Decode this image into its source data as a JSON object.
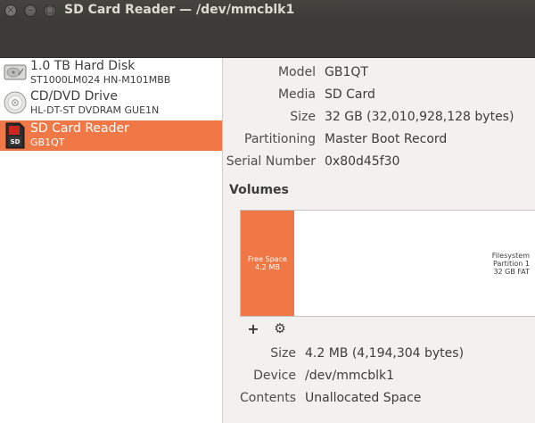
{
  "window": {
    "title": "SD Card Reader — /dev/mmcblk1",
    "close_glyph": "×",
    "minimize_glyph": "–",
    "maximize_glyph": "□"
  },
  "devices": [
    {
      "name": "1.0 TB Hard Disk",
      "sub": "ST1000LM024 HN-M101MBB",
      "icon": "hard-disk-icon",
      "selected": false
    },
    {
      "name": "CD/DVD Drive",
      "sub": "HL-DT-ST DVDRAM GUE1N",
      "icon": "optical-drive-icon",
      "selected": false
    },
    {
      "name": "SD Card Reader",
      "sub": "GB1QT",
      "icon": "sd-card-icon",
      "icon_text": "SD",
      "selected": true
    }
  ],
  "drive_properties": [
    {
      "label": "Model",
      "value": "GB1QT"
    },
    {
      "label": "Media",
      "value": "SD Card"
    },
    {
      "label": "Size",
      "value": "32 GB (32,010,928,128 bytes)"
    },
    {
      "label": "Partitioning",
      "value": "Master Boot Record"
    },
    {
      "label": "Serial Number",
      "value": "0x80d45f30"
    }
  ],
  "volumes": {
    "heading": "Volumes",
    "segments": [
      {
        "line1": "Free Space",
        "line2": "4.2 MB",
        "selected": true
      },
      {
        "line1": "Filesystem",
        "line2": "Partition 1",
        "line3": "32 GB FAT",
        "selected": false
      }
    ],
    "add_glyph": "+",
    "settings_glyph": "⚙"
  },
  "volume_properties": [
    {
      "label": "Size",
      "value": "4.2 MB (4,194,304 bytes)"
    },
    {
      "label": "Device",
      "value": "/dev/mmcblk1"
    },
    {
      "label": "Contents",
      "value": "Unallocated Space"
    }
  ],
  "colors": {
    "accent": "#f07746",
    "titlebar": "#3c3b37",
    "background": "#f2f1f0"
  }
}
